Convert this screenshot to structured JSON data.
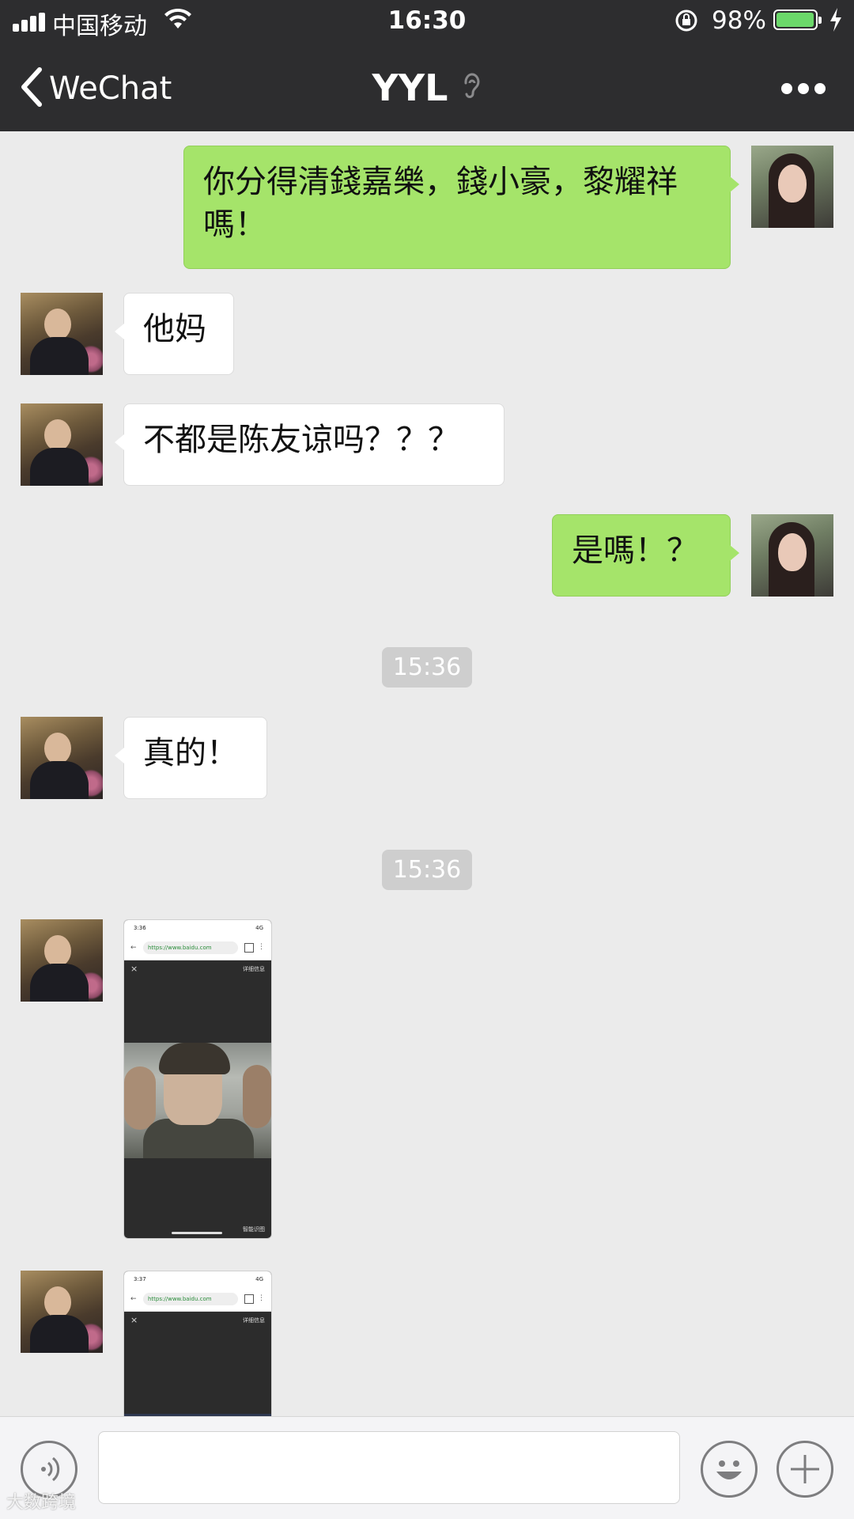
{
  "status_bar": {
    "carrier": "中国移动",
    "time": "16:30",
    "battery_percent": "98%",
    "battery_level": 0.98
  },
  "nav": {
    "back_label": "WeChat",
    "title": "YYL"
  },
  "messages": [
    {
      "from": "me",
      "avatar": "woman-avatar",
      "text": "你分得清錢嘉樂，錢小豪，黎耀祥嗎！"
    },
    {
      "from": "contact",
      "avatar": "man-avatar",
      "text": "他妈"
    },
    {
      "from": "contact",
      "avatar": "man-avatar",
      "text": "不都是陈友谅吗？？？"
    },
    {
      "from": "me",
      "avatar": "woman-avatar",
      "text": "是嗎！？"
    },
    {
      "timestamp": "15:36"
    },
    {
      "from": "contact",
      "avatar": "man-avatar",
      "text": "真的！"
    },
    {
      "timestamp": "15:36"
    },
    {
      "from": "contact",
      "type": "image",
      "shot": {
        "time": "3:36",
        "network": "4G",
        "url": "https://www.baidu.com",
        "info": "详细信息",
        "footer": "智能识图"
      }
    },
    {
      "from": "contact",
      "type": "image",
      "shot": {
        "time": "3:37",
        "network": "4G",
        "url": "https://www.baidu.com",
        "info": "详细信息"
      }
    }
  ],
  "watermark": "大数跨境",
  "icons": {
    "back": "chevron-left-icon",
    "ear": "ear-icon",
    "more": "more-dots-icon",
    "voice": "voice-icon",
    "emoji": "emoji-icon",
    "plus": "plus-icon"
  },
  "colors": {
    "nav_bg": "#2d2d2f",
    "chat_bg": "#ebebeb",
    "outgoing_bubble": "#a5e46a",
    "incoming_bubble": "#ffffff",
    "battery_fill": "#6bd86a"
  }
}
